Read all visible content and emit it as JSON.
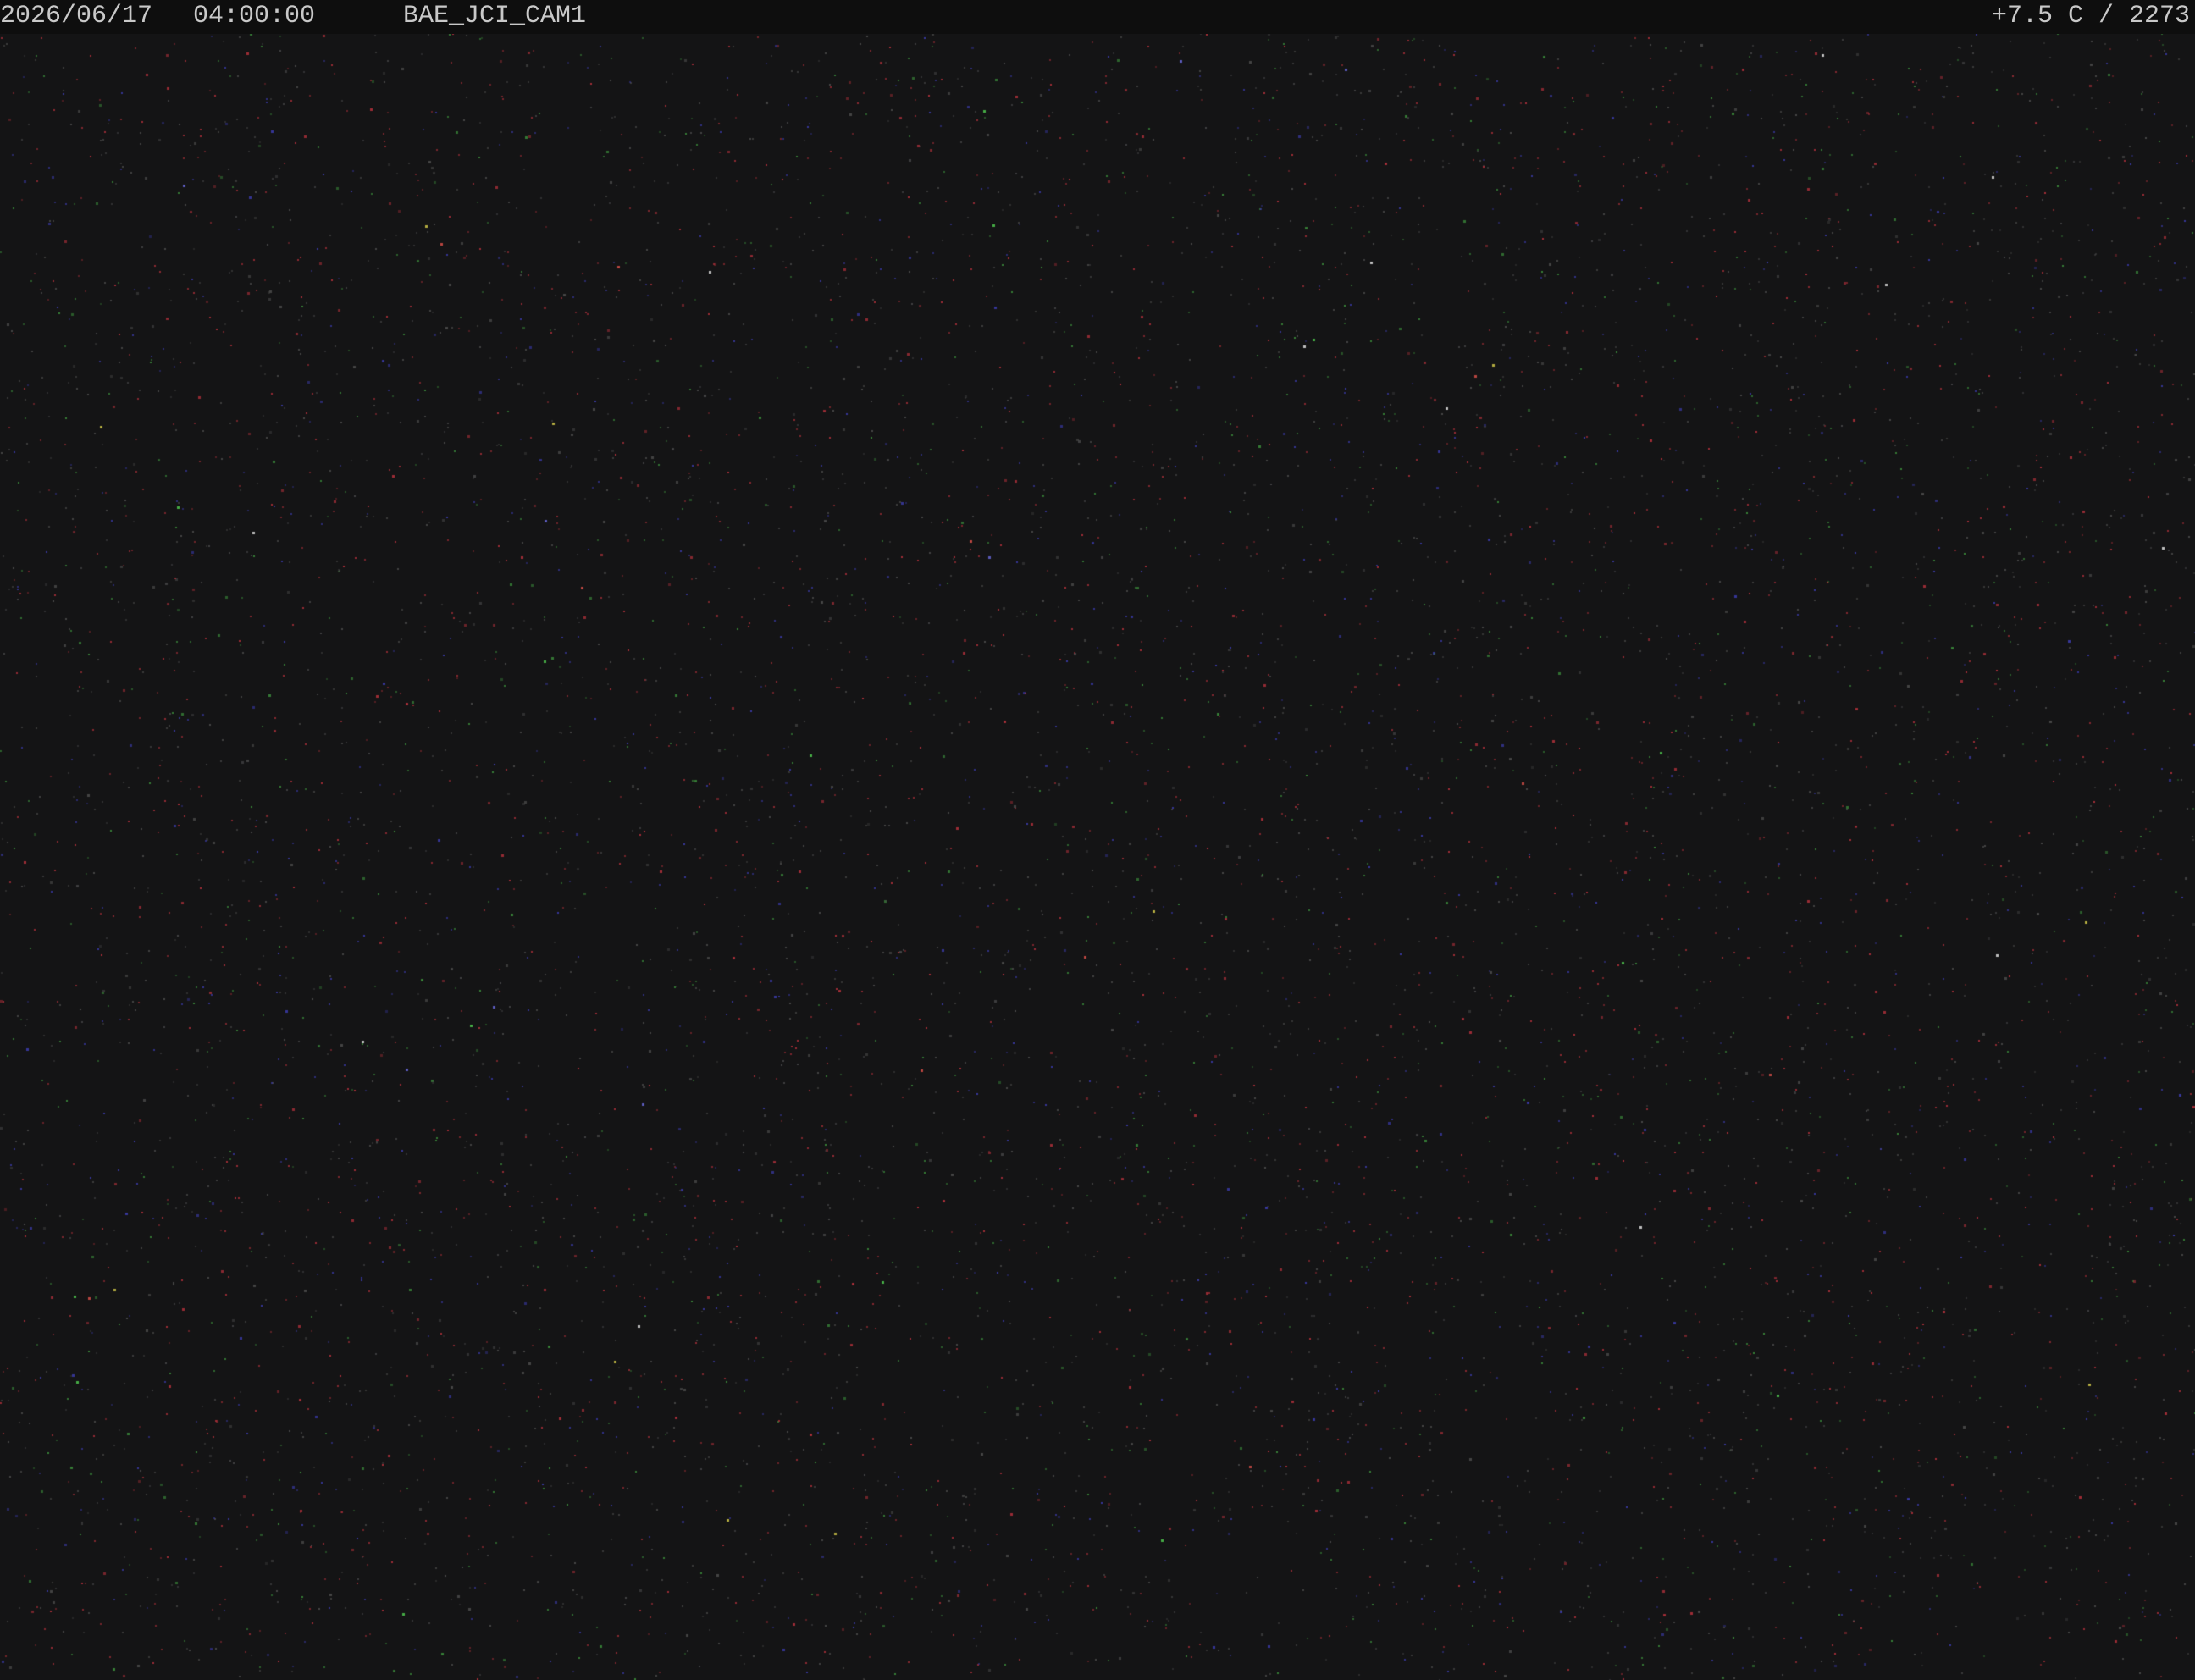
{
  "overlay": {
    "date": "2026/06/17",
    "time": "04:00:00",
    "camera_id": "BAE_JCI_CAM1",
    "temperature": "+7.5 C",
    "separator": "/",
    "exposure_value": "2273",
    "right_text": "+7.5 C / 2273"
  },
  "colors": {
    "background": "#141415",
    "overlay_bar": "#0e0e0e",
    "overlay_text": "#c9c9c9",
    "noise_red": "#b0303a",
    "noise_blue": "#3a3aa8",
    "noise_green": "#3a8a3a",
    "noise_grey": "#4a4a4a"
  }
}
